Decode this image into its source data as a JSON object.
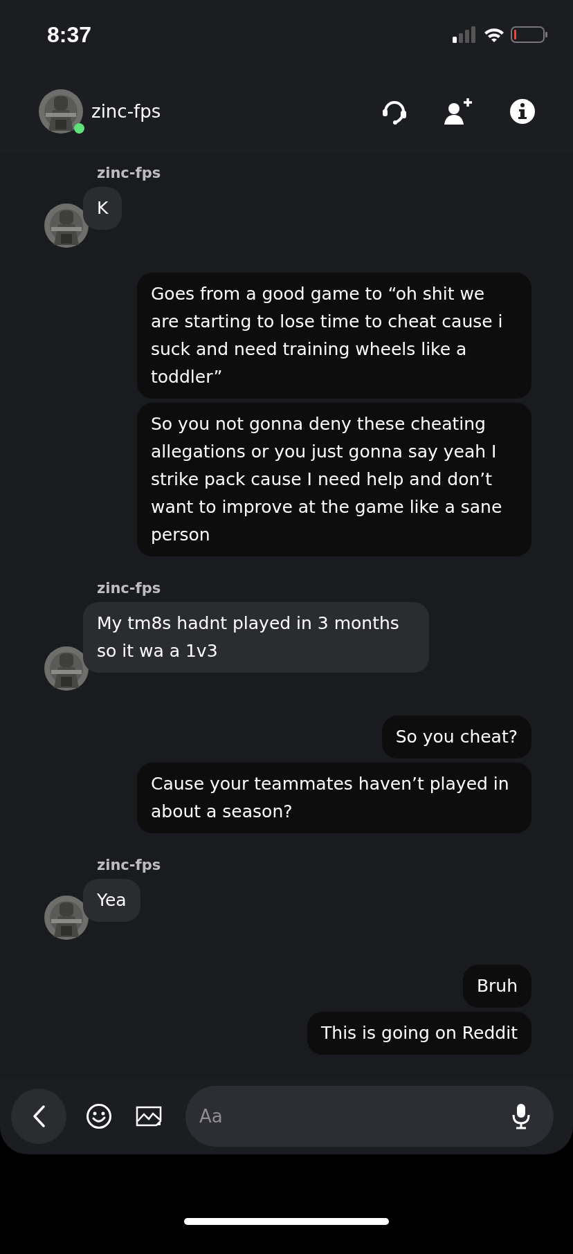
{
  "status_bar": {
    "time": "8:37"
  },
  "header": {
    "name": "zinc-fps",
    "online": true
  },
  "messages": [
    {
      "kind": "incoming",
      "sender": "zinc-fps",
      "bubbles": [
        "K"
      ]
    },
    {
      "kind": "outgoing",
      "bubbles": [
        "Goes from a good game to “oh shit we are starting to lose time to cheat cause i suck and need training wheels like a toddler”",
        "So you not gonna deny these cheating allegations or you just gonna say yeah I strike pack cause I need help and don’t want to improve at the game like a sane person"
      ]
    },
    {
      "kind": "incoming",
      "sender": "zinc-fps",
      "bubbles": [
        "My tm8s hadnt played in 3 months so it wa a 1v3"
      ]
    },
    {
      "kind": "outgoing",
      "bubbles": [
        "So you cheat?",
        "Cause your teammates haven’t played in about a season?"
      ]
    },
    {
      "kind": "incoming",
      "sender": "zinc-fps",
      "bubbles": [
        "Yea"
      ]
    },
    {
      "kind": "outgoing",
      "bubbles": [
        "Bruh",
        "This is going on Reddit"
      ]
    }
  ],
  "composer": {
    "placeholder": "Aa"
  }
}
